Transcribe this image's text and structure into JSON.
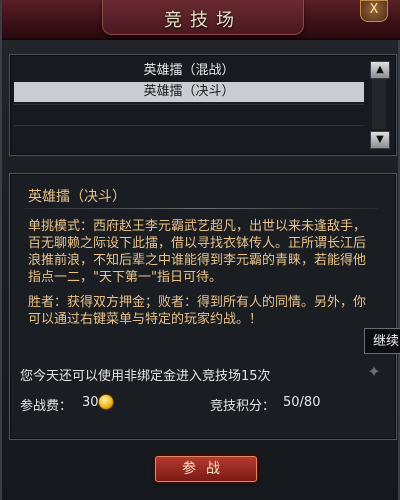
{
  "window": {
    "title": "竞技场",
    "close_label": "X"
  },
  "arena_list": {
    "items": [
      {
        "label": "英雄擂（混战）",
        "selected": false
      },
      {
        "label": "英雄擂（决斗）",
        "selected": true
      }
    ],
    "scroll_up_icon": "arrow-up-icon",
    "scroll_down_icon": "arrow-down-icon"
  },
  "detail": {
    "heading": "英雄擂（决斗）",
    "description": "单挑模式：西府赵王李元霸武艺超凡，出世以来未逢敌手，百无聊赖之际设下此擂，借以寻找衣钵传人。正所谓长江后浪推前浪，不知后辈之中谁能得到李元霸的青睐，若能得他指点一二，\"天下第一\"指日可待。",
    "result": "胜者：获得双方押金；败者：得到所有人的同情。另外，你可以通过右键菜单与特定的玩家约战。！"
  },
  "info": {
    "entries_text": "您今天还可以使用非绑定金进入竞技场15次",
    "cost_label": "参战费：",
    "cost_value": "30",
    "score_label": "竞技积分：",
    "score_value": "50/80"
  },
  "side_tab": {
    "label": "继续"
  },
  "actions": {
    "join_label": "参战"
  },
  "colors": {
    "text_gold": "#e9c38a",
    "selected_row": "#c9ccd0",
    "button_red": "#b33a30"
  }
}
